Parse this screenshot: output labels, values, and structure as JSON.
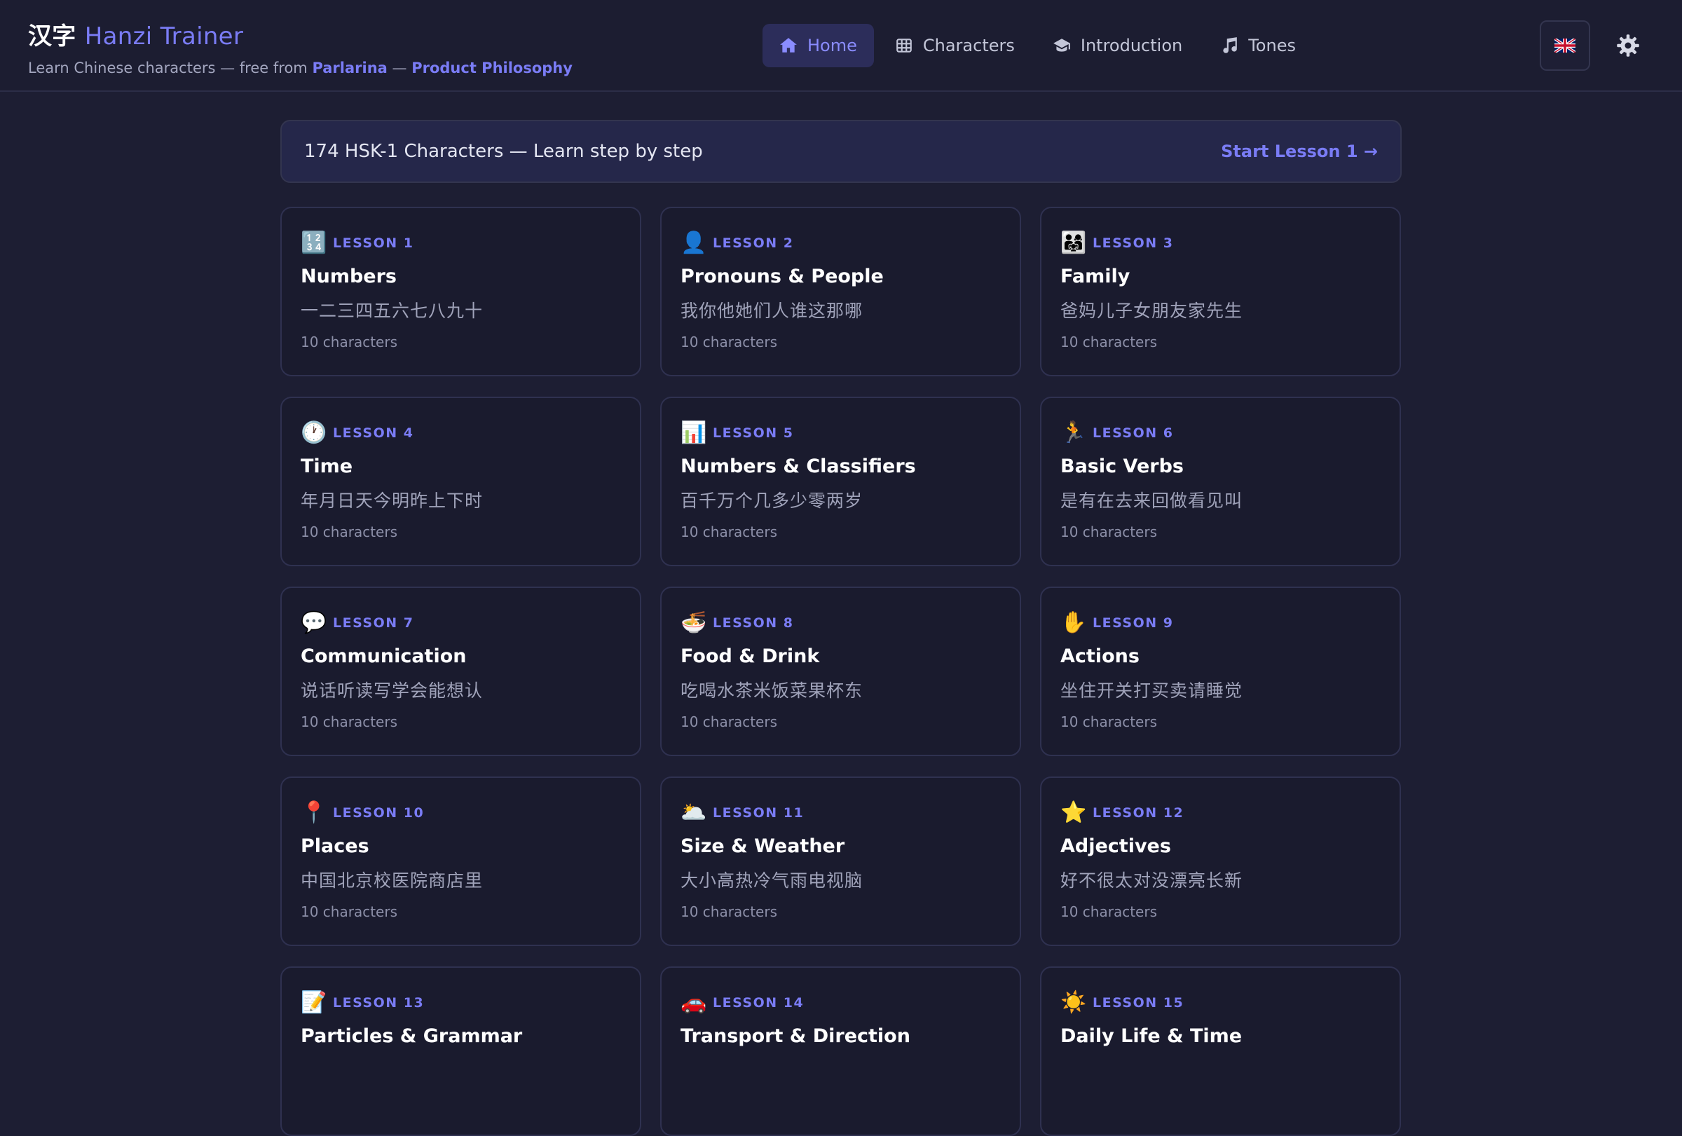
{
  "header": {
    "brand_hanzi": "汉字",
    "brand_name": "Hanzi Trainer",
    "subtitle_prefix": "Learn Chinese characters — free from",
    "subtitle_link1": "Parlarina",
    "subtitle_sep": "—",
    "subtitle_link2": "Product Philosophy",
    "nav": [
      {
        "label": "Home",
        "icon": "home-icon",
        "active": true
      },
      {
        "label": "Characters",
        "icon": "grid-icon"
      },
      {
        "label": "Introduction",
        "icon": "graduation-cap-icon"
      },
      {
        "label": "Tones",
        "icon": "music-note-icon"
      }
    ],
    "language_flag": "🇬🇧"
  },
  "banner": {
    "text": "174 HSK-1 Characters — Learn step by step",
    "cta": "Start Lesson 1 →"
  },
  "lessons": [
    {
      "icon": "🔢",
      "number": "LESSON 1",
      "title": "Numbers",
      "chars": "一二三四五六七八九十",
      "count": "10 characters"
    },
    {
      "icon": "👤",
      "number": "LESSON 2",
      "title": "Pronouns & People",
      "chars": "我你他她们人谁这那哪",
      "count": "10 characters"
    },
    {
      "icon": "👨‍👩‍👧",
      "number": "LESSON 3",
      "title": "Family",
      "chars": "爸妈儿子女朋友家先生",
      "count": "10 characters"
    },
    {
      "icon": "🕐",
      "number": "LESSON 4",
      "title": "Time",
      "chars": "年月日天今明昨上下时",
      "count": "10 characters"
    },
    {
      "icon": "📊",
      "number": "LESSON 5",
      "title": "Numbers & Classifiers",
      "chars": "百千万个几多少零两岁",
      "count": "10 characters"
    },
    {
      "icon": "🏃",
      "number": "LESSON 6",
      "title": "Basic Verbs",
      "chars": "是有在去来回做看见叫",
      "count": "10 characters"
    },
    {
      "icon": "💬",
      "number": "LESSON 7",
      "title": "Communication",
      "chars": "说话听读写学会能想认",
      "count": "10 characters"
    },
    {
      "icon": "🍜",
      "number": "LESSON 8",
      "title": "Food & Drink",
      "chars": "吃喝水茶米饭菜果杯东",
      "count": "10 characters"
    },
    {
      "icon": "✋",
      "number": "LESSON 9",
      "title": "Actions",
      "chars": "坐住开关打买卖请睡觉",
      "count": "10 characters"
    },
    {
      "icon": "📍",
      "number": "LESSON 10",
      "title": "Places",
      "chars": "中国北京校医院商店里",
      "count": "10 characters"
    },
    {
      "icon": "🌥️",
      "number": "LESSON 11",
      "title": "Size & Weather",
      "chars": "大小高热冷气雨电视脑",
      "count": "10 characters"
    },
    {
      "icon": "⭐",
      "number": "LESSON 12",
      "title": "Adjectives",
      "chars": "好不很太对没漂亮长新",
      "count": "10 characters"
    },
    {
      "icon": "📝",
      "number": "LESSON 13",
      "title": "Particles & Grammar",
      "chars": "",
      "count": ""
    },
    {
      "icon": "🚗",
      "number": "LESSON 14",
      "title": "Transport & Direction",
      "chars": "",
      "count": ""
    },
    {
      "icon": "☀️",
      "number": "LESSON 15",
      "title": "Daily Life & Time",
      "chars": "",
      "count": ""
    }
  ],
  "colors": {
    "background": "#1d1e33",
    "card": "#1a1b2e",
    "accent": "#7a7cf5",
    "border": "#2f3150"
  }
}
